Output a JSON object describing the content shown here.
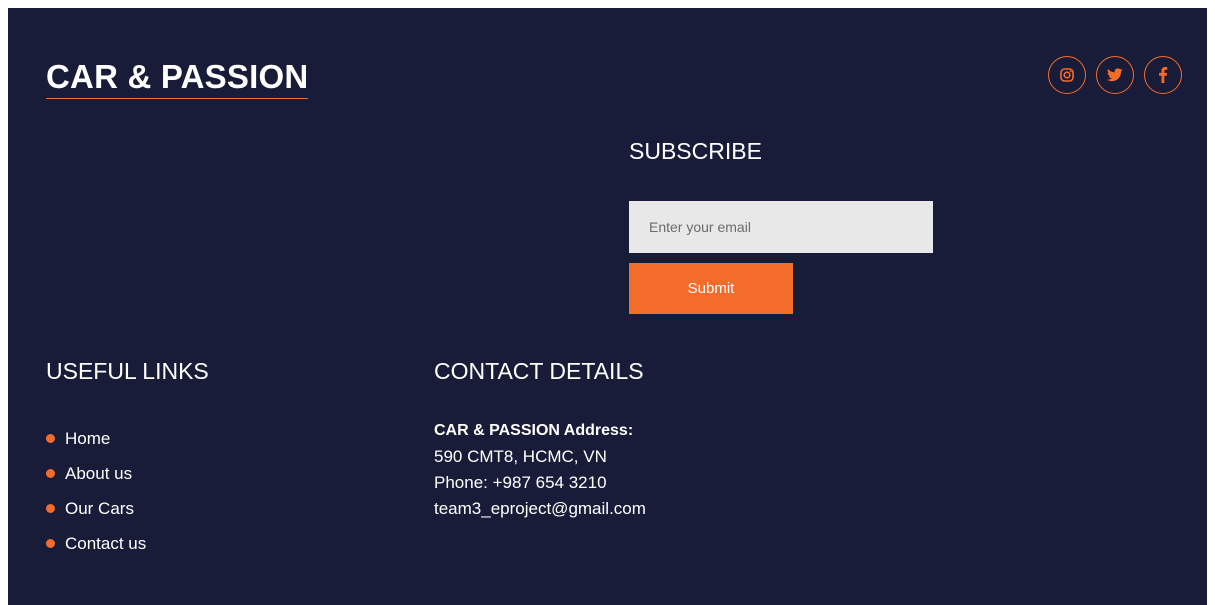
{
  "brand": {
    "name": "CAR & PASSION"
  },
  "socials": [
    {
      "icon": "instagram-icon"
    },
    {
      "icon": "twitter-icon"
    },
    {
      "icon": "facebook-icon"
    }
  ],
  "subscribe": {
    "title": "SUBSCRIBE",
    "email_placeholder": "Enter your email",
    "email_value": "",
    "submit_label": "Submit"
  },
  "useful_links": {
    "title": "USEFUL LINKS",
    "items": [
      {
        "label": "Home"
      },
      {
        "label": "About us"
      },
      {
        "label": "Our Cars"
      },
      {
        "label": "Contact us"
      }
    ]
  },
  "contact": {
    "title": "CONTACT DETAILS",
    "address_label": "CAR & PASSION Address:",
    "address": "590 CMT8, HCMC, VN",
    "phone": "Phone: +987 654 3210",
    "email": "team3_eproject@gmail.com"
  },
  "colors": {
    "background": "#181c38",
    "accent": "#f36c2a",
    "input_bg": "#e8e8e8",
    "text": "#ffffff"
  }
}
